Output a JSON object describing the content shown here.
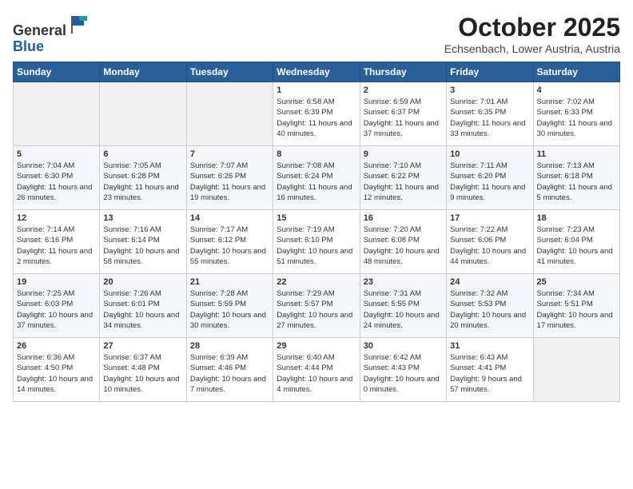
{
  "header": {
    "logo_line1": "General",
    "logo_line2": "Blue",
    "month": "October 2025",
    "location": "Echsenbach, Lower Austria, Austria"
  },
  "weekdays": [
    "Sunday",
    "Monday",
    "Tuesday",
    "Wednesday",
    "Thursday",
    "Friday",
    "Saturday"
  ],
  "weeks": [
    [
      {
        "day": "",
        "sunrise": "",
        "sunset": "",
        "daylight": ""
      },
      {
        "day": "",
        "sunrise": "",
        "sunset": "",
        "daylight": ""
      },
      {
        "day": "",
        "sunrise": "",
        "sunset": "",
        "daylight": ""
      },
      {
        "day": "1",
        "sunrise": "Sunrise: 6:58 AM",
        "sunset": "Sunset: 6:39 PM",
        "daylight": "Daylight: 11 hours and 40 minutes."
      },
      {
        "day": "2",
        "sunrise": "Sunrise: 6:59 AM",
        "sunset": "Sunset: 6:37 PM",
        "daylight": "Daylight: 11 hours and 37 minutes."
      },
      {
        "day": "3",
        "sunrise": "Sunrise: 7:01 AM",
        "sunset": "Sunset: 6:35 PM",
        "daylight": "Daylight: 11 hours and 33 minutes."
      },
      {
        "day": "4",
        "sunrise": "Sunrise: 7:02 AM",
        "sunset": "Sunset: 6:33 PM",
        "daylight": "Daylight: 11 hours and 30 minutes."
      }
    ],
    [
      {
        "day": "5",
        "sunrise": "Sunrise: 7:04 AM",
        "sunset": "Sunset: 6:30 PM",
        "daylight": "Daylight: 11 hours and 26 minutes."
      },
      {
        "day": "6",
        "sunrise": "Sunrise: 7:05 AM",
        "sunset": "Sunset: 6:28 PM",
        "daylight": "Daylight: 11 hours and 23 minutes."
      },
      {
        "day": "7",
        "sunrise": "Sunrise: 7:07 AM",
        "sunset": "Sunset: 6:26 PM",
        "daylight": "Daylight: 11 hours and 19 minutes."
      },
      {
        "day": "8",
        "sunrise": "Sunrise: 7:08 AM",
        "sunset": "Sunset: 6:24 PM",
        "daylight": "Daylight: 11 hours and 16 minutes."
      },
      {
        "day": "9",
        "sunrise": "Sunrise: 7:10 AM",
        "sunset": "Sunset: 6:22 PM",
        "daylight": "Daylight: 11 hours and 12 minutes."
      },
      {
        "day": "10",
        "sunrise": "Sunrise: 7:11 AM",
        "sunset": "Sunset: 6:20 PM",
        "daylight": "Daylight: 11 hours and 9 minutes."
      },
      {
        "day": "11",
        "sunrise": "Sunrise: 7:13 AM",
        "sunset": "Sunset: 6:18 PM",
        "daylight": "Daylight: 11 hours and 5 minutes."
      }
    ],
    [
      {
        "day": "12",
        "sunrise": "Sunrise: 7:14 AM",
        "sunset": "Sunset: 6:16 PM",
        "daylight": "Daylight: 11 hours and 2 minutes."
      },
      {
        "day": "13",
        "sunrise": "Sunrise: 7:16 AM",
        "sunset": "Sunset: 6:14 PM",
        "daylight": "Daylight: 10 hours and 58 minutes."
      },
      {
        "day": "14",
        "sunrise": "Sunrise: 7:17 AM",
        "sunset": "Sunset: 6:12 PM",
        "daylight": "Daylight: 10 hours and 55 minutes."
      },
      {
        "day": "15",
        "sunrise": "Sunrise: 7:19 AM",
        "sunset": "Sunset: 6:10 PM",
        "daylight": "Daylight: 10 hours and 51 minutes."
      },
      {
        "day": "16",
        "sunrise": "Sunrise: 7:20 AM",
        "sunset": "Sunset: 6:08 PM",
        "daylight": "Daylight: 10 hours and 48 minutes."
      },
      {
        "day": "17",
        "sunrise": "Sunrise: 7:22 AM",
        "sunset": "Sunset: 6:06 PM",
        "daylight": "Daylight: 10 hours and 44 minutes."
      },
      {
        "day": "18",
        "sunrise": "Sunrise: 7:23 AM",
        "sunset": "Sunset: 6:04 PM",
        "daylight": "Daylight: 10 hours and 41 minutes."
      }
    ],
    [
      {
        "day": "19",
        "sunrise": "Sunrise: 7:25 AM",
        "sunset": "Sunset: 6:03 PM",
        "daylight": "Daylight: 10 hours and 37 minutes."
      },
      {
        "day": "20",
        "sunrise": "Sunrise: 7:26 AM",
        "sunset": "Sunset: 6:01 PM",
        "daylight": "Daylight: 10 hours and 34 minutes."
      },
      {
        "day": "21",
        "sunrise": "Sunrise: 7:28 AM",
        "sunset": "Sunset: 5:59 PM",
        "daylight": "Daylight: 10 hours and 30 minutes."
      },
      {
        "day": "22",
        "sunrise": "Sunrise: 7:29 AM",
        "sunset": "Sunset: 5:57 PM",
        "daylight": "Daylight: 10 hours and 27 minutes."
      },
      {
        "day": "23",
        "sunrise": "Sunrise: 7:31 AM",
        "sunset": "Sunset: 5:55 PM",
        "daylight": "Daylight: 10 hours and 24 minutes."
      },
      {
        "day": "24",
        "sunrise": "Sunrise: 7:32 AM",
        "sunset": "Sunset: 5:53 PM",
        "daylight": "Daylight: 10 hours and 20 minutes."
      },
      {
        "day": "25",
        "sunrise": "Sunrise: 7:34 AM",
        "sunset": "Sunset: 5:51 PM",
        "daylight": "Daylight: 10 hours and 17 minutes."
      }
    ],
    [
      {
        "day": "26",
        "sunrise": "Sunrise: 6:36 AM",
        "sunset": "Sunset: 4:50 PM",
        "daylight": "Daylight: 10 hours and 14 minutes."
      },
      {
        "day": "27",
        "sunrise": "Sunrise: 6:37 AM",
        "sunset": "Sunset: 4:48 PM",
        "daylight": "Daylight: 10 hours and 10 minutes."
      },
      {
        "day": "28",
        "sunrise": "Sunrise: 6:39 AM",
        "sunset": "Sunset: 4:46 PM",
        "daylight": "Daylight: 10 hours and 7 minutes."
      },
      {
        "day": "29",
        "sunrise": "Sunrise: 6:40 AM",
        "sunset": "Sunset: 4:44 PM",
        "daylight": "Daylight: 10 hours and 4 minutes."
      },
      {
        "day": "30",
        "sunrise": "Sunrise: 6:42 AM",
        "sunset": "Sunset: 4:43 PM",
        "daylight": "Daylight: 10 hours and 0 minutes."
      },
      {
        "day": "31",
        "sunrise": "Sunrise: 6:43 AM",
        "sunset": "Sunset: 4:41 PM",
        "daylight": "Daylight: 9 hours and 57 minutes."
      },
      {
        "day": "",
        "sunrise": "",
        "sunset": "",
        "daylight": ""
      }
    ]
  ]
}
